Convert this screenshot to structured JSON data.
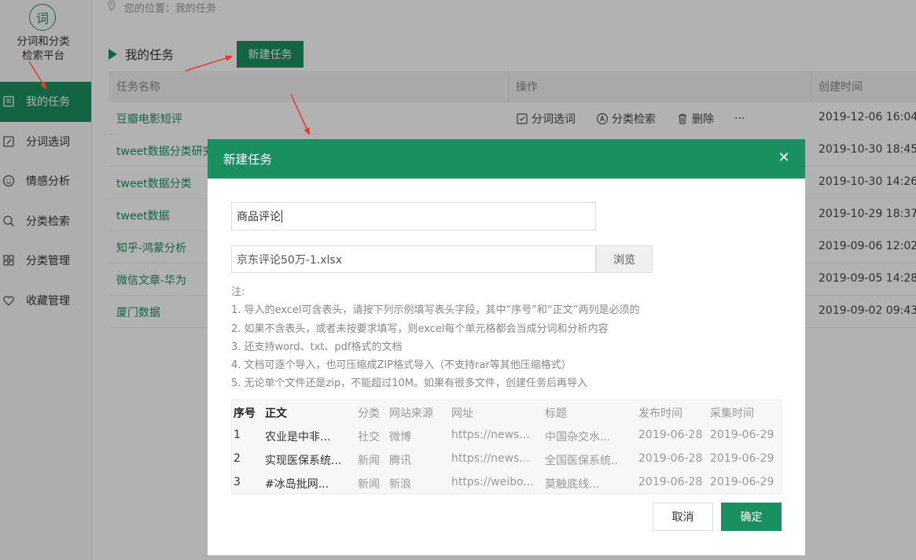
{
  "app": {
    "logo_char": "词",
    "title_line1": "分词和分类",
    "title_line2": "检索平台"
  },
  "sidebar": {
    "items": [
      {
        "label": "我的任务",
        "icon": "task-list-icon",
        "active": true
      },
      {
        "label": "分词选词",
        "icon": "edit-icon"
      },
      {
        "label": "情感分析",
        "icon": "smile-icon"
      },
      {
        "label": "分类检索",
        "icon": "search-icon"
      },
      {
        "label": "分类管理",
        "icon": "grid-icon"
      },
      {
        "label": "收藏管理",
        "icon": "heart-icon"
      }
    ]
  },
  "breadcrumb": "您的位置：我的任务",
  "section_title": "我的任务",
  "new_task_label": "新建任务",
  "table": {
    "headers": [
      "任务名称",
      "操作",
      "创建时间"
    ],
    "ops": {
      "segment": "分词选词",
      "classify": "分类检索",
      "delete": "删除",
      "more": "···"
    },
    "rows": [
      {
        "name": "豆瓣电影短评",
        "time": "2019-12-06 16:04"
      },
      {
        "name": "tweet数据分类研究",
        "time": "2019-10-30 18:45"
      },
      {
        "name": "tweet数据分类",
        "time": "2019-10-30 14:26"
      },
      {
        "name": "tweet数据",
        "time": "2019-10-29 18:37"
      },
      {
        "name": "知乎-鸿蒙分析",
        "time": "2019-09-06 12:02"
      },
      {
        "name": "微信文章-华为",
        "time": "2019-09-05 14:28"
      },
      {
        "name": "厦门数据",
        "time": "2019-09-02 09:43"
      }
    ]
  },
  "modal": {
    "title": "新建任务",
    "close": "✕",
    "name_value": "商品评论",
    "file_value": "京东评论50万-1.xlsx",
    "browse_label": "浏览",
    "notes": [
      "注:",
      "1. 导入的excel可含表头，请按下列示例填写表头字段，其中“序号”和“正文”两列是必须的",
      "2. 如果不含表头，或者未按要求填写，则excel每个单元格都会当成分词和分析内容",
      "3. 还支持word、txt、pdf格式的文档",
      "4. 文档可逐个导入，也可压缩成ZIP格式导入（不支持rar等其他压缩格式）",
      "5. 无论单个文件还是zip，不能超过10M。如果有很多文件，创建任务后再导入"
    ],
    "sample": {
      "headers": [
        "序号",
        "正文",
        "分类",
        "网站来源",
        "网址",
        "标题",
        "发布时间",
        "采集时间"
      ],
      "rows": [
        [
          "1",
          "农业是中非...",
          "社交",
          "微博",
          "https://news...",
          "中国杂交水...",
          "2019-06-28",
          "2019-06-29"
        ],
        [
          "2",
          "实现医保系统...",
          "新闻",
          "腾讯",
          "https://news...",
          "全国医保系统..",
          "2019-06-28",
          "2019-06-29"
        ],
        [
          "3",
          "#冰岛批网...",
          "新闻",
          "新浪",
          "https://weibo...",
          "莫触底线...",
          "2019-06-28",
          "2019-06-29"
        ]
      ]
    },
    "cancel_label": "取消",
    "ok_label": "确定"
  },
  "colors": {
    "accent": "#1a9060",
    "annotation": "#e8392b"
  }
}
